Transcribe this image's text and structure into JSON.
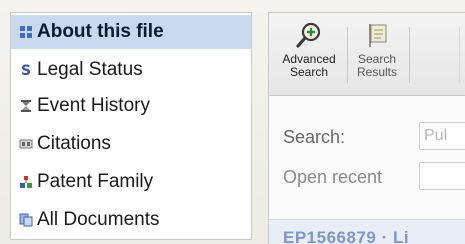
{
  "sidebar": {
    "items": [
      {
        "label": "About this file",
        "icon": "info-grid-icon",
        "selected": true
      },
      {
        "label": "Legal Status",
        "icon": "section-sign-icon",
        "selected": false
      },
      {
        "label": "Event History",
        "icon": "hourglass-icon",
        "selected": false
      },
      {
        "label": "Citations",
        "icon": "quote-box-icon",
        "selected": false
      },
      {
        "label": "Patent Family",
        "icon": "family-tree-icon",
        "selected": false
      },
      {
        "label": "All Documents",
        "icon": "documents-icon",
        "selected": false
      }
    ]
  },
  "toolbar": {
    "advanced_search": {
      "line1": "Advanced",
      "line2": "Search",
      "icon": "magnifier-plus-icon"
    },
    "search_results": {
      "line1": "Search",
      "line2": "Results",
      "icon": "results-flag-icon"
    }
  },
  "form": {
    "search_label": "Search:",
    "search_value": "Pul",
    "open_recent_label": "Open recent",
    "open_recent_value": ""
  },
  "results": {
    "first_link": "EP1566879 · Li"
  },
  "colors": {
    "selected_bg": "#c8d9f0",
    "link": "#5a79c4"
  }
}
